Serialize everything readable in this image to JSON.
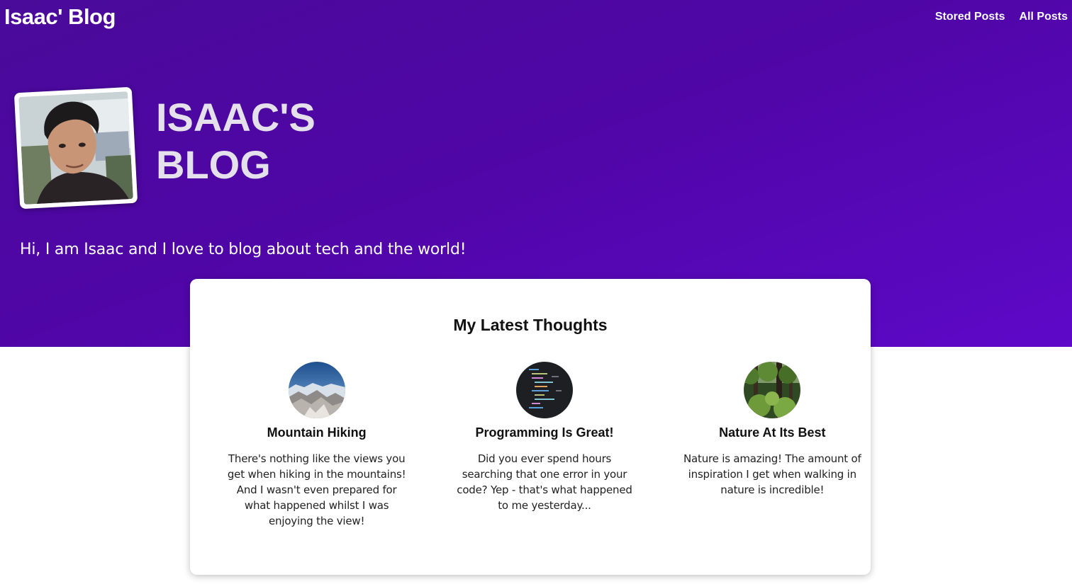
{
  "header": {
    "brand": "Isaac' Blog",
    "nav": [
      {
        "label": "Stored Posts"
      },
      {
        "label": "All Posts"
      }
    ]
  },
  "hero": {
    "title_line1": "ISAAC'S",
    "title_line2": "BLOG",
    "intro": "Hi, I am Isaac and I love to blog about tech and the world!",
    "avatar_icon": "profile-photo"
  },
  "latest": {
    "heading": "My Latest Thoughts",
    "posts": [
      {
        "title": "Mountain Hiking",
        "excerpt": "There's nothing like the views you get when hiking in the mountains! And I wasn't even prepared for what happened whilst I was enjoying the view!",
        "image_icon": "mountains-thumbnail"
      },
      {
        "title": "Programming Is Great!",
        "excerpt": "Did you ever spend hours searching that one error in your code? Yep - that's what happened to me yesterday...",
        "image_icon": "code-thumbnail"
      },
      {
        "title": "Nature At Its Best",
        "excerpt": "Nature is amazing! The amount of inspiration I get when walking in nature is incredible!",
        "image_icon": "forest-thumbnail"
      }
    ]
  },
  "colors": {
    "hero_gradient_start": "#4a0a9a",
    "hero_gradient_end": "#5e08c8",
    "card_bg": "#ffffff",
    "hero_title": "#e4e1ec"
  }
}
